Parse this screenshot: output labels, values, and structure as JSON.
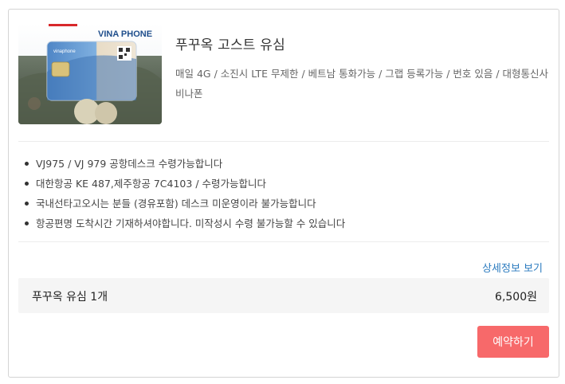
{
  "product": {
    "image_brand_text": "VINA PHONE",
    "image_card_text": "vinaphone",
    "title": "푸꾸옥 고스트 유심",
    "description": "매일 4G / 소진시 LTE 무제한 / 베트남 통화가능 / 그랩 등록가능 / 번호 있음 / 대형통신사 비나폰"
  },
  "notes": [
    "VJ975 / VJ 979 공항데스크 수령가능합니다",
    "대한항공 KE 487,제주항공 7C4103 / 수령가능합니다",
    "국내선타고오시는 분들 (경유포함) 데스크 미운영이라 불가능합니다",
    "항공편명 도착시간 기재하셔야합니다. 미작성시 수령 불가능할 수 있습니다"
  ],
  "detail_link": "상세정보 보기",
  "price_row": {
    "name": "푸꾸옥 유심 1개",
    "price": "6,500원"
  },
  "reserve_button": "예약하기",
  "colors": {
    "accent_button": "#f7696a",
    "link": "#2b7bbf",
    "price_row_bg": "#f5f5f5",
    "border": "#d4d4d4"
  }
}
